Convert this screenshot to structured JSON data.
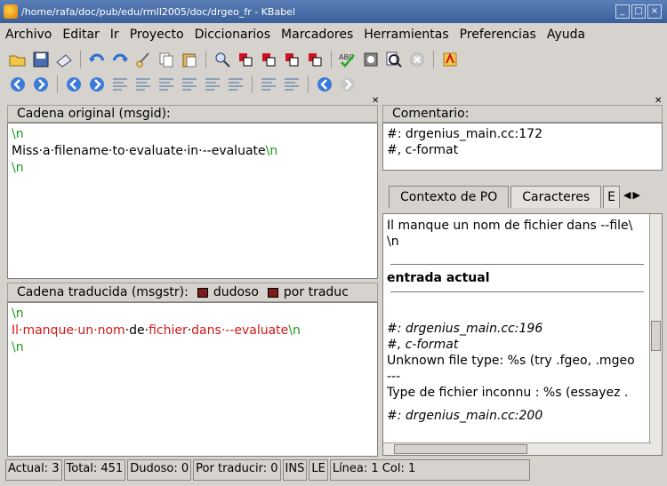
{
  "window": {
    "title": "/home/rafa/doc/pub/edu/rmll2005/doc/drgeo_fr - KBabel"
  },
  "menu": [
    "Archivo",
    "Editar",
    "Ir",
    "Proyecto",
    "Diccionarios",
    "Marcadores",
    "Herramientas",
    "Preferencias",
    "Ayuda"
  ],
  "original": {
    "header": "Cadena original (msgid):",
    "line1": "\\n",
    "line2_text": "Miss·a·filename·to·evaluate·in·--evaluate",
    "line2_tag": "\\n",
    "line3": "\\n"
  },
  "translated": {
    "header": "Cadena traducida (msgstr):",
    "fuzzy_label": "dudoso",
    "untranslated_label": "por traduc",
    "line1": "\\n",
    "seg1": "Il·manque·un·",
    "seg2": "nom",
    "seg3": "·de·",
    "seg4": "fichier",
    "seg5": "·",
    "seg6": "dans",
    "seg7": "·--evaluate",
    "line2_tag": "\\n",
    "line3": "\\n"
  },
  "comment": {
    "header": "Comentario:",
    "line1": "#: drgenius_main.cc:172",
    "line2": "#, c-format"
  },
  "tabs": {
    "tab1": "Contexto de PO",
    "tab2": "Caracteres",
    "tab3": "E"
  },
  "context": {
    "l1": "Il manque un nom de fichier dans --file\\",
    "l2": "\\n",
    "current_entry": "entrada actual",
    "l3": "#: drgenius_main.cc:196",
    "l4": "#, c-format",
    "l5": "Unknown file type: %s (try .fgeo, .mgeo",
    "l6": "---",
    "l7": "Type de fichier inconnu : %s (essayez .",
    "l8": "#: drgenius_main.cc:200"
  },
  "status": {
    "actual": "Actual: 3",
    "total": "Total: 451",
    "fuzzy": "Dudoso: 0",
    "untranslated": "Por traducir: 0",
    "ins": "INS",
    "le": "LE",
    "position": "Línea: 1 Col: 1"
  }
}
